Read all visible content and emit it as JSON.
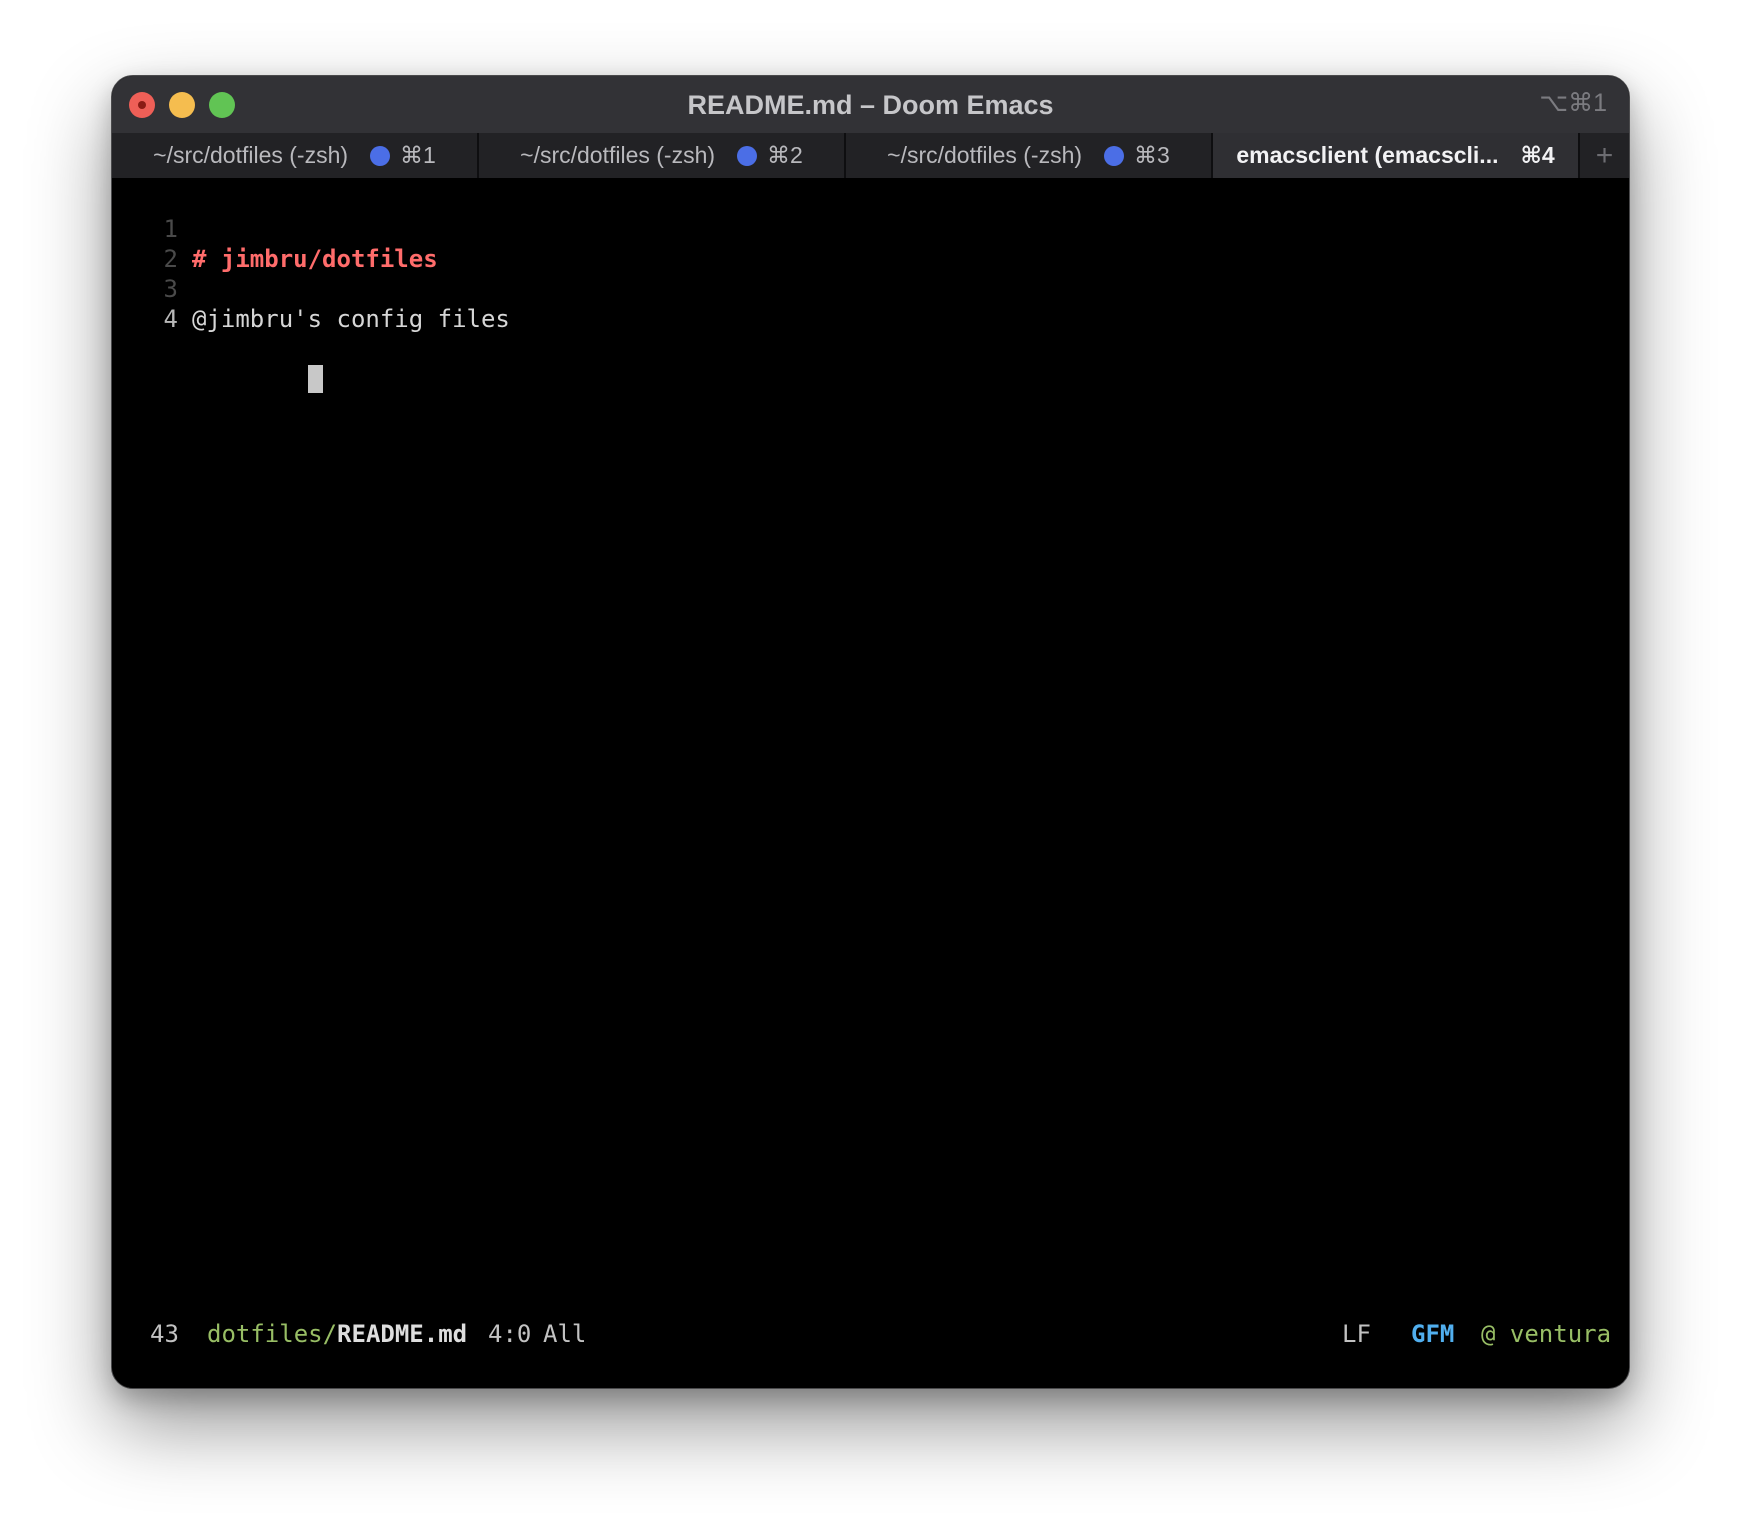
{
  "window": {
    "title": "README.md – Doom Emacs",
    "shortcut": "⌥⌘1"
  },
  "tabs": [
    {
      "label": "~/src/dotfiles (-zsh)",
      "key": "⌘1",
      "active": false
    },
    {
      "label": "~/src/dotfiles (-zsh)",
      "key": "⌘2",
      "active": false
    },
    {
      "label": "~/src/dotfiles (-zsh)",
      "key": "⌘3",
      "active": false
    },
    {
      "label": "emacsclient (emacscli...",
      "key": "⌘4",
      "active": true
    }
  ],
  "tab_add": "+",
  "editor": {
    "lines": [
      {
        "number": "1",
        "text": "# jimbru/dotfiles"
      },
      {
        "number": "2",
        "text": ""
      },
      {
        "number": "3",
        "text": "@jimbru's config files"
      },
      {
        "number": "4",
        "text": ""
      }
    ]
  },
  "modeline": {
    "line_count": "43",
    "dir": "dotfiles/",
    "file": "README.md",
    "position": "4:0",
    "scroll": "All",
    "eol": "LF",
    "mode": "GFM",
    "host": "@ ventura"
  },
  "colors": {
    "heading": "#ff6c6b",
    "dir": "#98be65",
    "mode": "#51afef",
    "tab_dot": "#4b6ee6"
  }
}
